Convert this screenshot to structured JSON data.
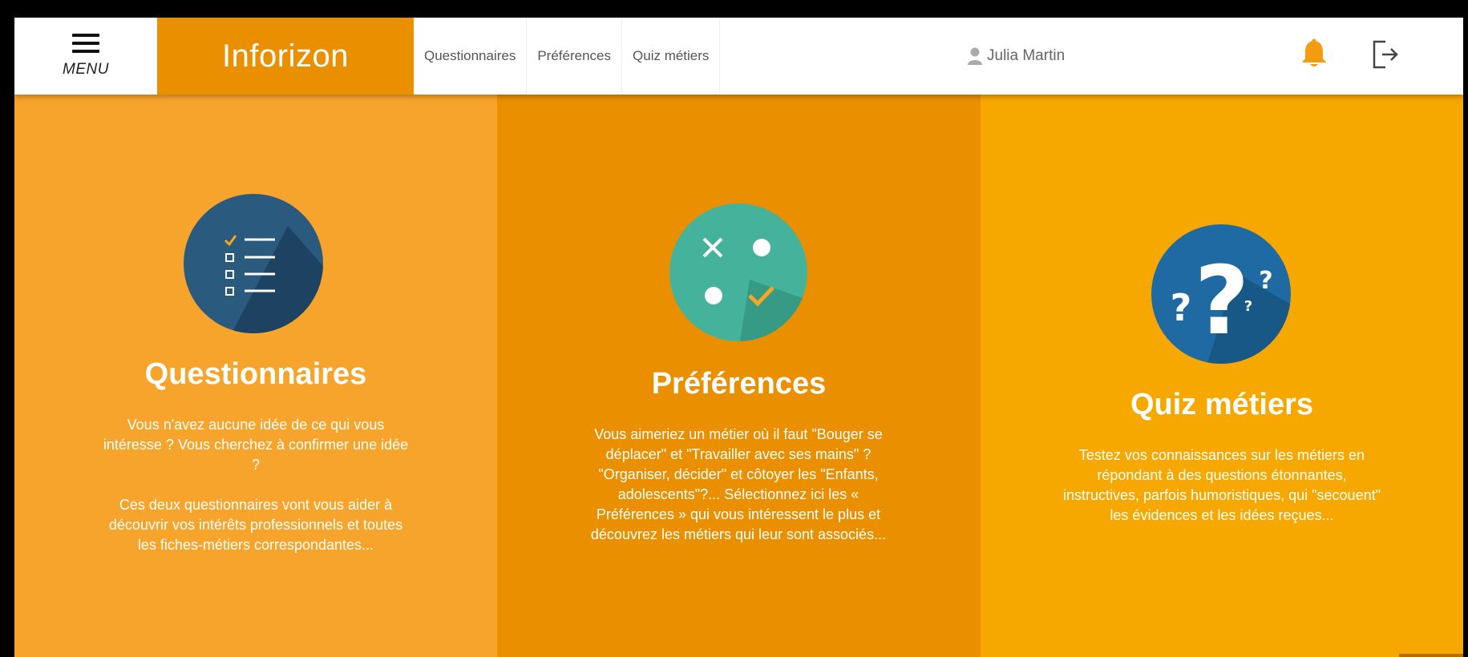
{
  "header": {
    "menu_label": "MENU",
    "logo_text": "Inforizon",
    "nav": [
      "Questionnaires",
      "Préférences",
      "Quiz métiers"
    ],
    "user_name": "Julia Martin"
  },
  "panels": [
    {
      "title": "Questionnaires",
      "paragraphs": [
        "Vous n'avez aucune idée de ce qui vous intéresse ? Vous cherchez à confirmer une idée ?",
        "Ces deux questionnaires vont vous aider à découvrir vos intérêts professionnels et toutes les fiches-métiers correspondantes..."
      ]
    },
    {
      "title": "Préférences",
      "paragraphs": [
        "Vous aimeriez un métier où il faut \"Bouger se déplacer\" et \"Travailler avec ses mains\" ? \"Organiser, décider\" et côtoyer les \"Enfants, adolescents\"?... Sélectionnez ici les « Préférences » qui vous intéressent le plus et découvrez les métiers qui leur sont associés..."
      ]
    },
    {
      "title": "Quiz métiers",
      "paragraphs": [
        "Testez vos connaissances sur les métiers en répondant à des questions étonnantes, instructives, parfois humoristiques, qui \"secouent\" les évidences et les idées reçues..."
      ]
    }
  ],
  "colors": {
    "logo_bg": "#e98f00",
    "panel1": "#f7a42c",
    "panel2": "#e98f00",
    "panel3": "#f7a800",
    "icon1": "#2a5a7e",
    "icon2": "#45b39b",
    "icon3": "#1f6aa3",
    "bell": "#f39c12"
  },
  "icons": {
    "questionnaires": "checklist-icon",
    "preferences": "tic-tac-toe-icon",
    "quiz": "question-marks-icon"
  }
}
